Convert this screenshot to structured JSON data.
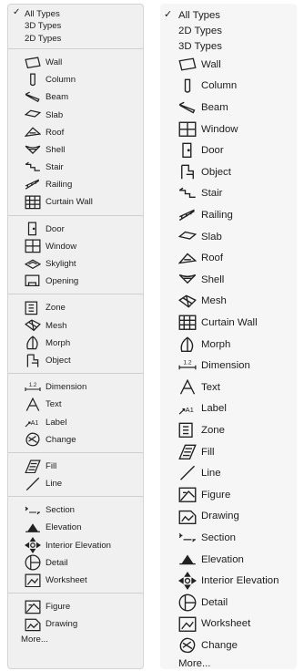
{
  "left_menu": {
    "types": [
      "All Types",
      "3D Types",
      "2D Types"
    ],
    "groups": [
      [
        {
          "label": "Wall",
          "icon": "wall-icon"
        },
        {
          "label": "Column",
          "icon": "column-icon"
        },
        {
          "label": "Beam",
          "icon": "beam-icon"
        },
        {
          "label": "Slab",
          "icon": "slab-icon"
        },
        {
          "label": "Roof",
          "icon": "roof-icon"
        },
        {
          "label": "Shell",
          "icon": "shell-icon"
        },
        {
          "label": "Stair",
          "icon": "stair-icon"
        },
        {
          "label": "Railing",
          "icon": "railing-icon"
        },
        {
          "label": "Curtain Wall",
          "icon": "curtain-wall-icon"
        }
      ],
      [
        {
          "label": "Door",
          "icon": "door-icon"
        },
        {
          "label": "Window",
          "icon": "window-icon"
        },
        {
          "label": "Skylight",
          "icon": "skylight-icon"
        },
        {
          "label": "Opening",
          "icon": "opening-icon"
        }
      ],
      [
        {
          "label": "Zone",
          "icon": "zone-icon"
        },
        {
          "label": "Mesh",
          "icon": "mesh-icon"
        },
        {
          "label": "Morph",
          "icon": "morph-icon"
        },
        {
          "label": "Object",
          "icon": "object-icon"
        }
      ],
      [
        {
          "label": "Dimension",
          "icon": "dimension-icon"
        },
        {
          "label": "Text",
          "icon": "text-icon"
        },
        {
          "label": "Label",
          "icon": "label-icon"
        },
        {
          "label": "Change",
          "icon": "change-icon"
        }
      ],
      [
        {
          "label": "Fill",
          "icon": "fill-icon"
        },
        {
          "label": "Line",
          "icon": "line-icon"
        }
      ],
      [
        {
          "label": "Section",
          "icon": "section-icon"
        },
        {
          "label": "Elevation",
          "icon": "elevation-icon"
        },
        {
          "label": "Interior Elevation",
          "icon": "interior-elevation-icon"
        },
        {
          "label": "Detail",
          "icon": "detail-icon"
        },
        {
          "label": "Worksheet",
          "icon": "worksheet-icon"
        }
      ],
      [
        {
          "label": "Figure",
          "icon": "figure-icon"
        },
        {
          "label": "Drawing",
          "icon": "drawing-icon"
        }
      ]
    ],
    "more": "More..."
  },
  "right_menu": {
    "types": [
      "All Types",
      "2D Types",
      "3D Types"
    ],
    "items": [
      {
        "label": "Wall",
        "icon": "wall-icon"
      },
      {
        "label": "Column",
        "icon": "column-icon"
      },
      {
        "label": "Beam",
        "icon": "beam-icon"
      },
      {
        "label": "Window",
        "icon": "window-icon"
      },
      {
        "label": "Door",
        "icon": "door-icon"
      },
      {
        "label": "Object",
        "icon": "object-icon"
      },
      {
        "label": "Stair",
        "icon": "stair-icon"
      },
      {
        "label": "Railing",
        "icon": "railing-icon"
      },
      {
        "label": "Slab",
        "icon": "slab-icon"
      },
      {
        "label": "Roof",
        "icon": "roof-icon"
      },
      {
        "label": "Shell",
        "icon": "shell-icon"
      },
      {
        "label": "Mesh",
        "icon": "mesh-icon"
      },
      {
        "label": "Curtain Wall",
        "icon": "curtain-wall-icon"
      },
      {
        "label": "Morph",
        "icon": "morph-icon"
      },
      {
        "label": "Dimension",
        "icon": "dimension-icon"
      },
      {
        "label": "Text",
        "icon": "text-icon"
      },
      {
        "label": "Label",
        "icon": "label-icon"
      },
      {
        "label": "Zone",
        "icon": "zone-icon"
      },
      {
        "label": "Fill",
        "icon": "fill-icon"
      },
      {
        "label": "Line",
        "icon": "line-icon"
      },
      {
        "label": "Figure",
        "icon": "figure-icon"
      },
      {
        "label": "Drawing",
        "icon": "drawing-icon"
      },
      {
        "label": "Section",
        "icon": "section-icon"
      },
      {
        "label": "Elevation",
        "icon": "elevation-icon"
      },
      {
        "label": "Interior Elevation",
        "icon": "interior-elevation-icon"
      },
      {
        "label": "Detail",
        "icon": "detail-icon"
      },
      {
        "label": "Worksheet",
        "icon": "worksheet-icon"
      },
      {
        "label": "Change",
        "icon": "change-icon"
      }
    ],
    "more": "More..."
  },
  "checkmark": "✓",
  "dimension_glyph": "1.2"
}
